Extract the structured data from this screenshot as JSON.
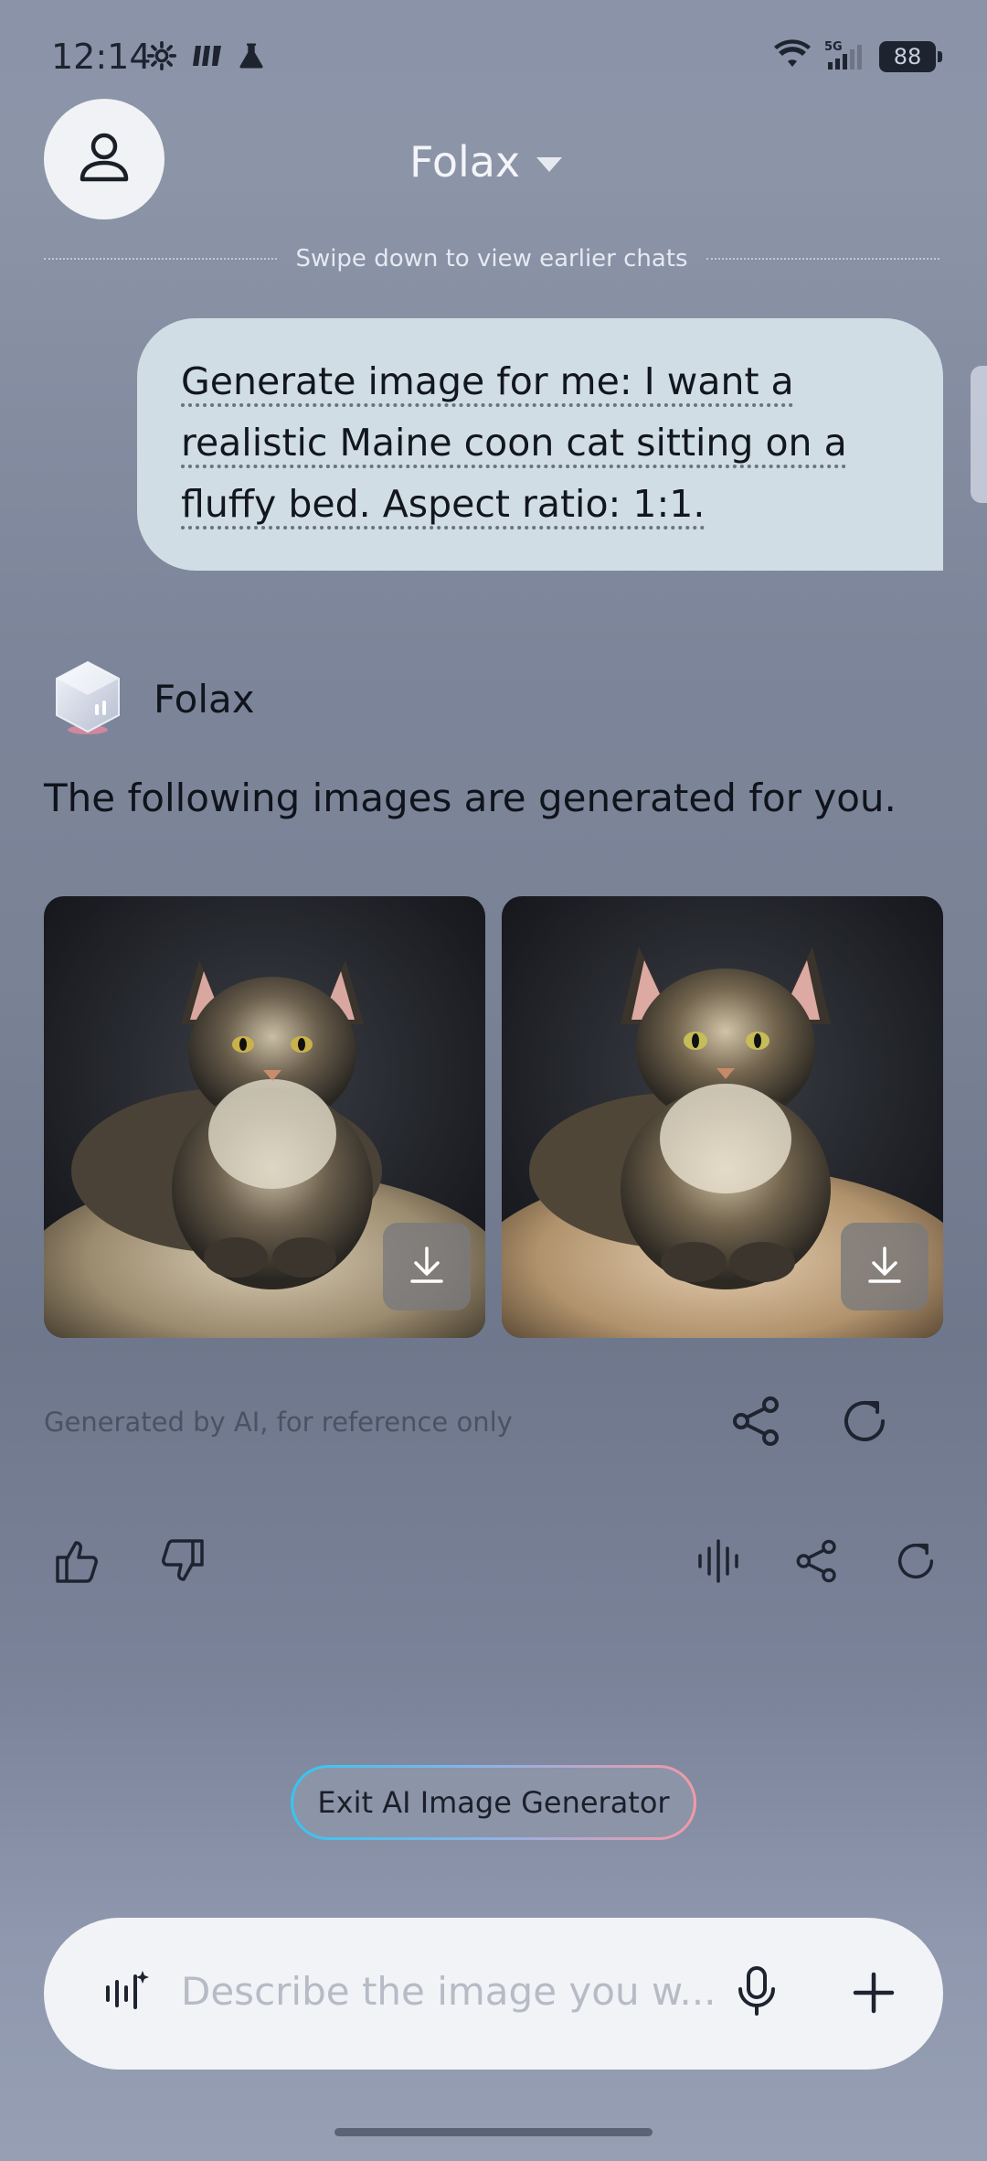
{
  "status_bar": {
    "time": "12:14",
    "battery": "88",
    "network": "5G"
  },
  "header": {
    "title": "Folax",
    "swipe_hint": "Swipe down to view earlier chats"
  },
  "user_message": {
    "lines": [
      "Generate image for me: I want a",
      "realistic Maine coon cat sitting on a",
      "fluffy bed. Aspect ratio: 1:1."
    ]
  },
  "assistant": {
    "name": "Folax",
    "text": "The following images are generated for you.",
    "disclaimer": "Generated by AI, for reference only",
    "images": [
      {
        "alt": "Maine coon cat on fluffy bed 1"
      },
      {
        "alt": "Maine coon cat on fluffy bed 2"
      }
    ]
  },
  "actions": {
    "exit_label": "Exit AI Image Generator"
  },
  "input": {
    "placeholder": "Describe the image you w..."
  },
  "colors": {
    "bubble": "#d1dde5",
    "input_bg": "#f2f3f6",
    "exit_gradient_start": "#35c6f0",
    "exit_gradient_end": "#f29aa6"
  }
}
